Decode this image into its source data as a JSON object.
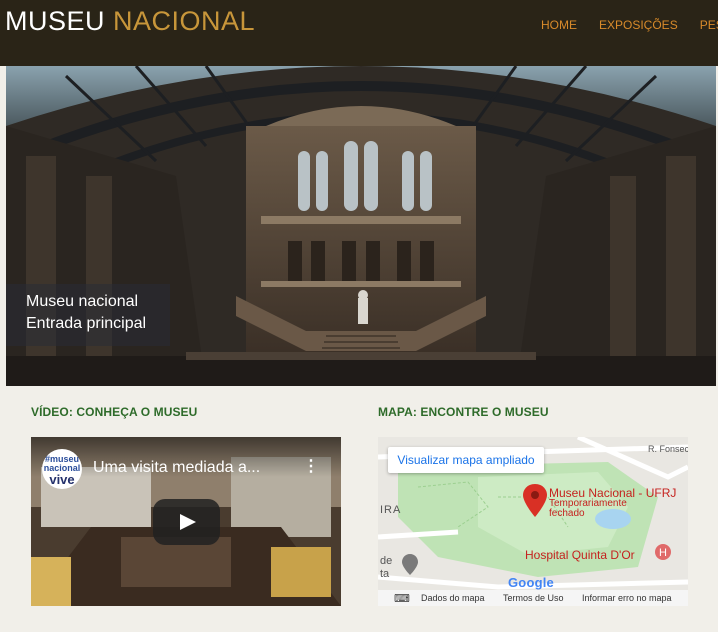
{
  "header": {
    "brand_main": "MUSEU",
    "brand_accent": "NACIONAL",
    "nav": [
      "HOME",
      "EXPOSIÇÕES",
      "PES"
    ]
  },
  "hero": {
    "caption_line1": "Museu nacional",
    "caption_line2": "Entrada principal"
  },
  "video_section": {
    "title": "VÍDEO: CONHEÇA O MUSEU",
    "video_title": "Uma visita mediada a...",
    "menu_icon": "⋮",
    "channel_logo": [
      "#museu",
      "nacional",
      "vive"
    ]
  },
  "map_section": {
    "title": "MAPA: ENCONTRE O MUSEU",
    "link": "Visualizar mapa ampliado",
    "place_name": "Museu Nacional - UFRJ",
    "place_status_1": "Temporariamente",
    "place_status_2": "fechado",
    "hospital": "Hospital Quinta D'Or",
    "road_1": "R. Fonseca",
    "road_2": "IRA",
    "road_3": "de",
    "road_4": "ta",
    "google": "Google",
    "footer": {
      "data": "Dados do mapa",
      "terms": "Termos de Uso",
      "report": "Informar erro no mapa"
    }
  },
  "colors": {
    "header_bg": "#2a2417",
    "brand_accent": "#c8963a",
    "nav": "#d88a2a",
    "section_title": "#2e6b2a",
    "page_bg": "#f1efe9"
  }
}
